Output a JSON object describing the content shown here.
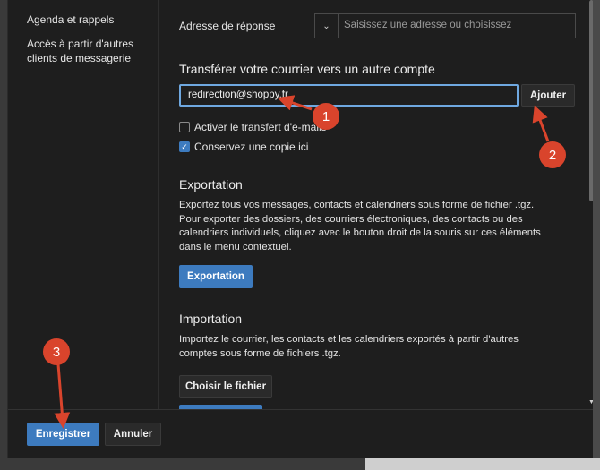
{
  "sidebar": {
    "items": [
      {
        "label": "Agenda et rappels"
      },
      {
        "label": "Accès à partir d'autres clients de messagerie"
      }
    ]
  },
  "reply": {
    "label": "Adresse de réponse",
    "placeholder": "Saisissez une adresse ou choisissez"
  },
  "forward": {
    "heading": "Transférer votre courrier vers un autre compte",
    "input_value": "redirection@shoppy.fr",
    "add_button": "Ajouter",
    "enable_label": "Activer le transfert d'e-mails",
    "enable_checked": false,
    "keep_copy_label": "Conservez une copie ici",
    "keep_copy_checked": true
  },
  "export": {
    "heading": "Exportation",
    "description": "Exportez tous vos messages, contacts et calendriers sous forme de fichier .tgz. Pour exporter des dossiers, des courriers électroniques, des contacts ou des calendriers individuels, cliquez avec le bouton droit de la souris sur ces éléments dans le menu contextuel.",
    "button": "Exportation"
  },
  "import": {
    "heading": "Importation",
    "description": "Importez le courrier, les contacts et les calendriers exportés à partir d'autres comptes sous forme de fichiers .tgz.",
    "button": "Choisir le fichier"
  },
  "footer": {
    "save_button": "Enregistrer",
    "cancel_button": "Annuler"
  },
  "annotations": [
    "1",
    "2",
    "3"
  ],
  "colors": {
    "accent": "#3d7bbf",
    "annotation": "#d9442c",
    "focus_border": "#6fa8e0"
  }
}
